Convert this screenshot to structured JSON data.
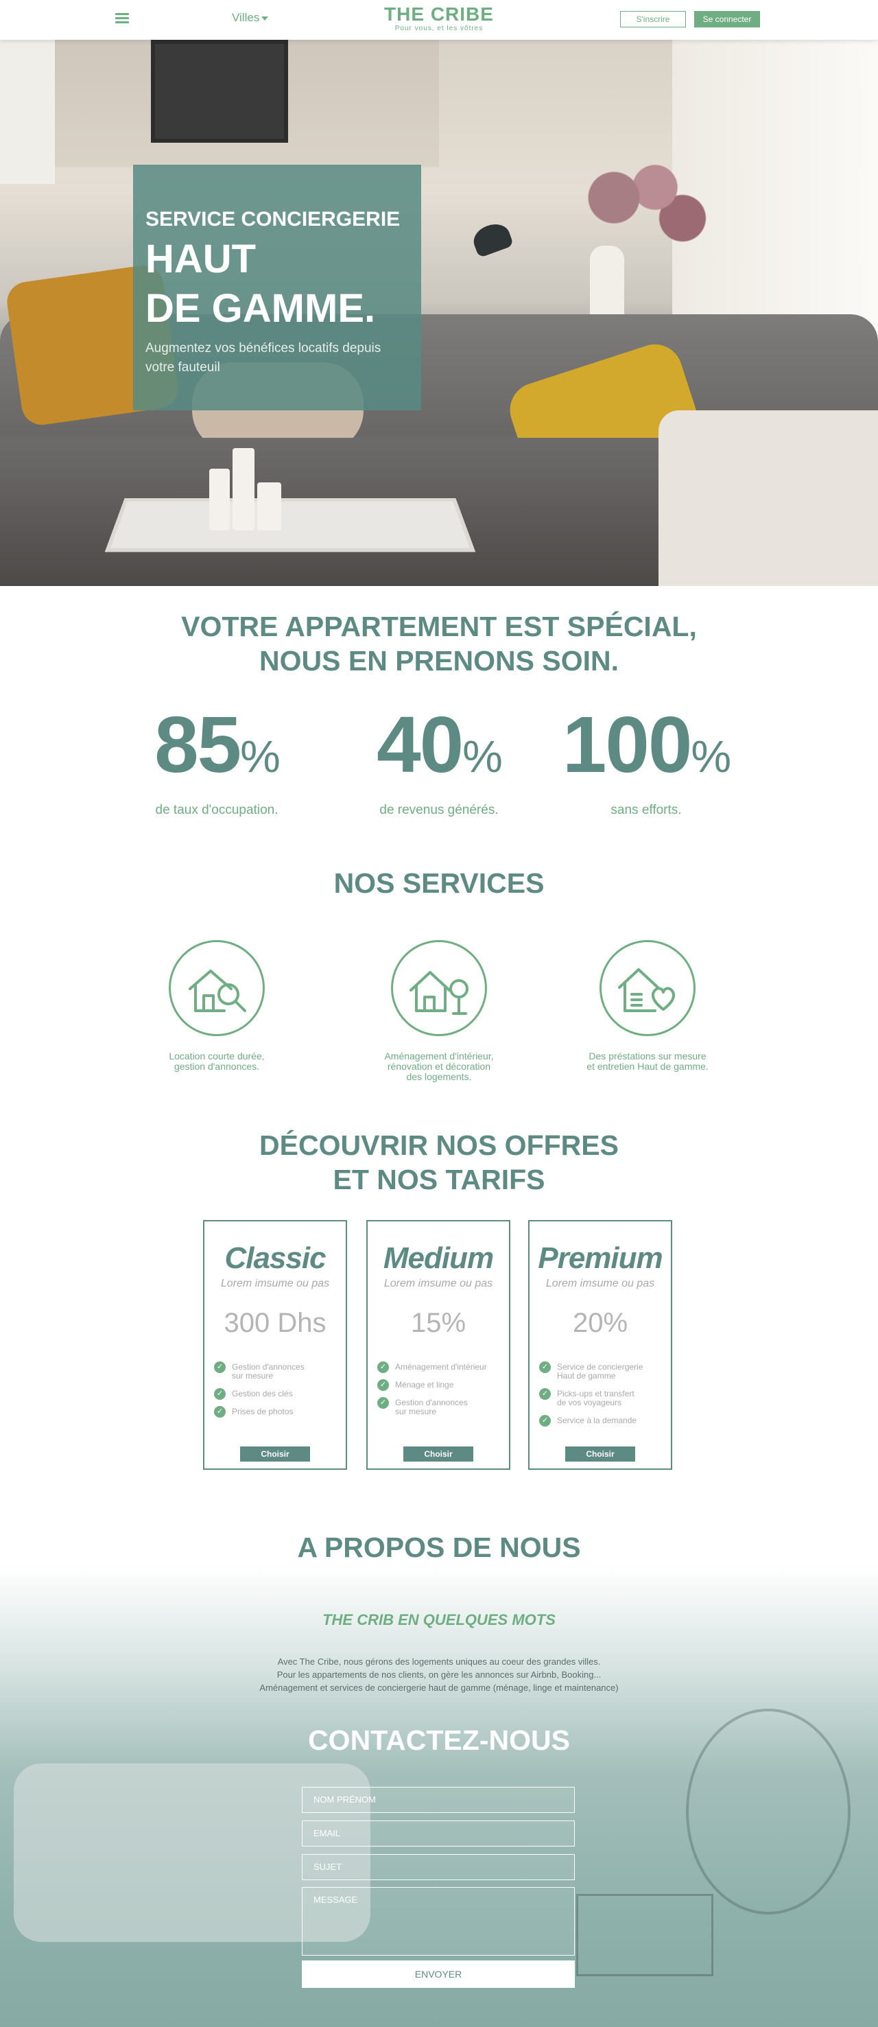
{
  "header": {
    "cities_label": "Villes",
    "logo_title": "THE CRIBE",
    "logo_subtitle": "Pour vous, et les vôtres",
    "signup_label": "S'inscrire",
    "login_label": "Se connecter"
  },
  "hero": {
    "kicker": "SERVICE CONCIERGERIE",
    "title_line1": "HAUT",
    "title_line2": "DE GAMME.",
    "tagline": "Augmentez vos bénéfices locatifs depuis votre fauteuil"
  },
  "stats": {
    "title_line1": "VOTRE APPARTEMENT EST SPÉCIAL,",
    "title_line2": "NOUS EN PRENONS SOIN.",
    "items": [
      {
        "value": "85",
        "unit": "%",
        "label": "de taux d'occupation."
      },
      {
        "value": "40",
        "unit": "%",
        "label": "de revenus générés."
      },
      {
        "value": "100",
        "unit": "%",
        "label": "sans efforts."
      }
    ]
  },
  "services": {
    "title": "NOS SERVICES",
    "items": [
      {
        "icon": "house-magnifier-icon",
        "label_line1": "Location courte durée,",
        "label_line2": "gestion d'annonces.",
        "label_line3": ""
      },
      {
        "icon": "house-tree-icon",
        "label_line1": "Aménagement d'intérieur,",
        "label_line2": "rénovation et décoration",
        "label_line3": "des logements."
      },
      {
        "icon": "house-heart-icon",
        "label_line1": "Des préstations sur mesure",
        "label_line2": "et entretien Haut de gamme.",
        "label_line3": ""
      }
    ]
  },
  "offers": {
    "title_line1": "DÉCOUVRIR NOS OFFRES",
    "title_line2": "ET NOS TARIFS",
    "choose_label": "Choisir",
    "plans": [
      {
        "name": "Classic",
        "subtitle": "Lorem imsume ou pas",
        "price": "300 Dhs",
        "features": [
          [
            "Gestion d'annonces",
            "sur mesure"
          ],
          [
            "Gestion des clés",
            ""
          ],
          [
            "Prises de photos",
            ""
          ]
        ]
      },
      {
        "name": "Medium",
        "subtitle": "Lorem imsume ou pas",
        "price": "15%",
        "features": [
          [
            "Aménagement d'intérieur",
            ""
          ],
          [
            "Ménage et linge",
            ""
          ],
          [
            "Gestion d'annonces",
            "sur mesure"
          ]
        ]
      },
      {
        "name": "Premium",
        "subtitle": "Lorem imsume ou pas",
        "price": "20%",
        "features": [
          [
            "Service de conciergerie",
            "Haut de gamme"
          ],
          [
            "Picks-ups et transfert",
            "de vos voyageurs"
          ],
          [
            "Service à la demande",
            ""
          ]
        ]
      }
    ]
  },
  "about": {
    "title": "A PROPOS DE NOUS",
    "subtitle": "THE CRIB EN QUELQUES MOTS",
    "line1": "Avec The Cribe, nous gérons des logements uniques au coeur des grandes villes.",
    "line2": "Pour les appartements de nos clients, on gère les annonces sur Airbnb, Booking...",
    "line3": "Aménagement et services de conciergerie haut de gamme (ménage, linge et maintenance)"
  },
  "contact": {
    "title": "CONTACTEZ-NOUS",
    "name_placeholder": "NOM PRÉNOM",
    "email_placeholder": "EMAIL",
    "subject_placeholder": "SUJET",
    "message_placeholder": "MESSAGE",
    "send_label": "ENVOYER"
  },
  "colors": {
    "brand_green": "#6fae82",
    "teal": "#5e8a84"
  }
}
